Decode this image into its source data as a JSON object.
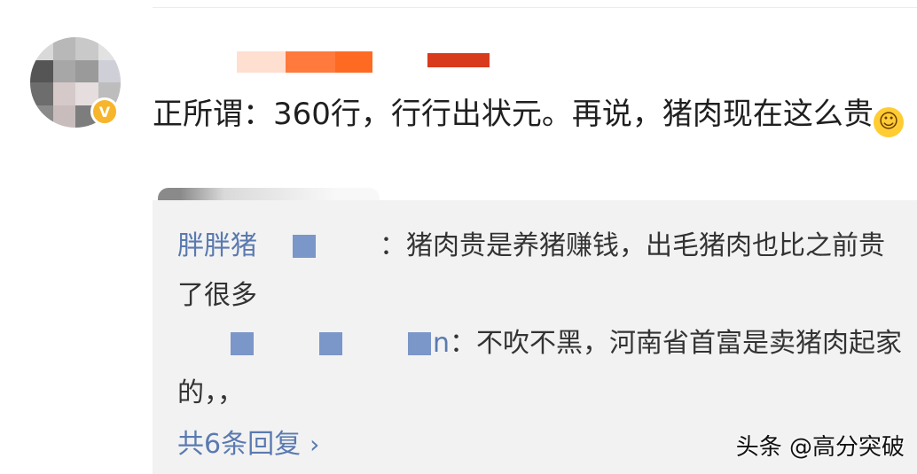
{
  "comment": {
    "text": "正所谓：360行，行行出状元。再说，猪肉现在这么贵",
    "emoji_name": "laugh-cry-emoji"
  },
  "replies": [
    {
      "user": "胖胖猪",
      "text": "：猪肉贵是养猪赚钱，出毛猪肉也比之前贵了很多"
    },
    {
      "user": "n",
      "text": "：不吹不黑，河南省首富是卖猪肉起家的，，"
    }
  ],
  "reply_count_label": "共6条回复",
  "watermark": "头条 @高分突破",
  "colors": {
    "link_blue": "#5a7ab0",
    "badge_gold": "#f7b52c",
    "reply_bg": "#f2f2f2"
  }
}
